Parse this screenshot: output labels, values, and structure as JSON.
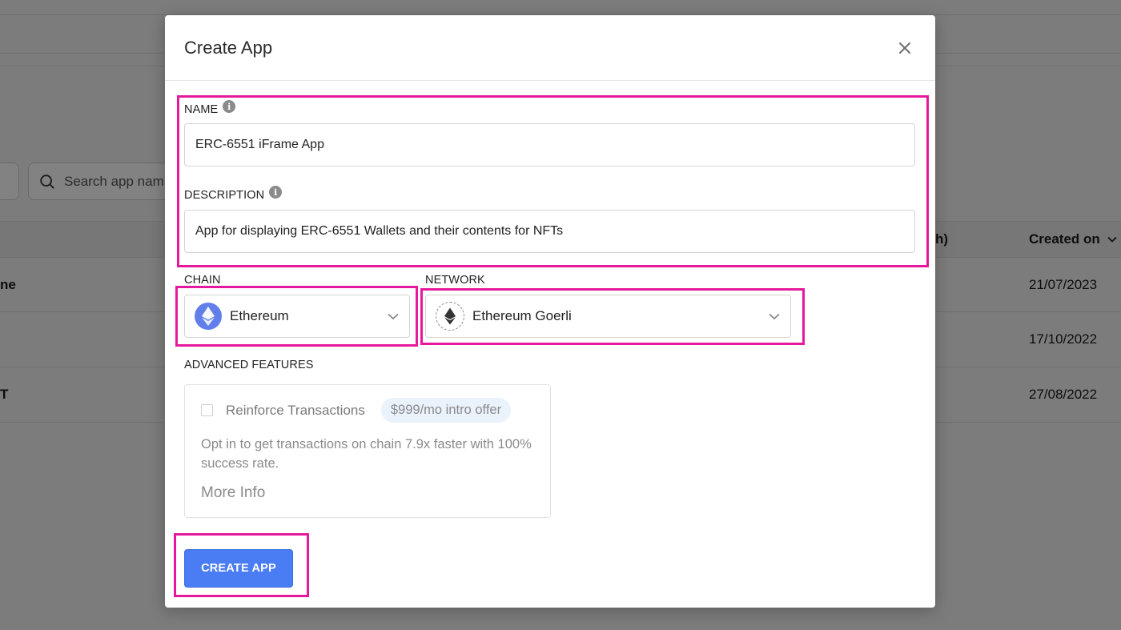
{
  "background": {
    "search_placeholder": "Search app nam",
    "table_header_partial": "h)",
    "created_on_header": "Created on",
    "rows": [
      {
        "name_fragment": "ne",
        "created": "21/07/2023"
      },
      {
        "name_fragment": "",
        "created": "17/10/2022"
      },
      {
        "name_fragment": "T",
        "created": "27/08/2022"
      }
    ]
  },
  "modal": {
    "title": "Create App",
    "close_icon": "close-icon",
    "name": {
      "label": "NAME",
      "value": "ERC-6551 iFrame App"
    },
    "description": {
      "label": "DESCRIPTION",
      "value": "App for displaying ERC-6551 Wallets and their contents for NFTs"
    },
    "chain": {
      "label": "CHAIN",
      "value": "Ethereum",
      "icon": "ethereum-icon"
    },
    "network": {
      "label": "NETWORK",
      "value": "Ethereum Goerli",
      "icon": "ethereum-icon"
    },
    "advanced": {
      "label": "ADVANCED FEATURES",
      "feature_title": "Reinforce Transactions",
      "offer": "$999/mo intro offer",
      "description": "Opt in to get transactions on chain 7.9x faster with 100% success rate.",
      "more_info": "More Info"
    },
    "submit_label": "CREATE APP"
  },
  "colors": {
    "accent": "#4a7df3",
    "highlight": "#e6199c",
    "ethereum": "#627eea"
  }
}
